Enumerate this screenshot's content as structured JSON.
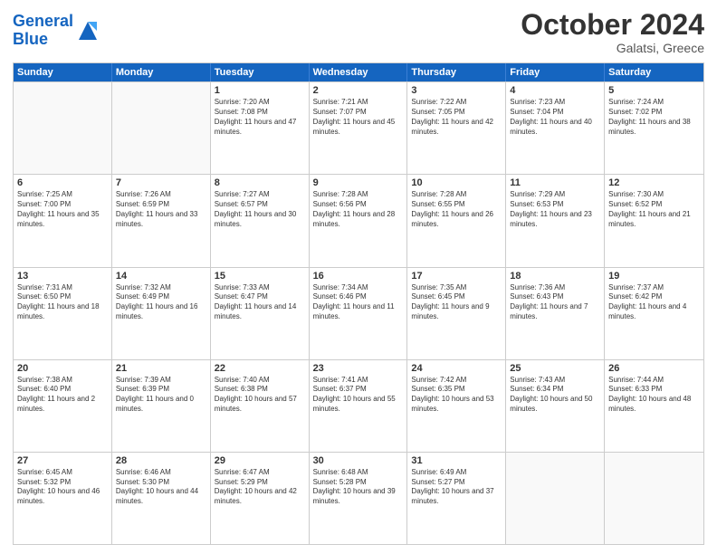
{
  "header": {
    "logo_general": "General",
    "logo_blue": "Blue",
    "month_title": "October 2024",
    "location": "Galatsi, Greece"
  },
  "calendar": {
    "days_of_week": [
      "Sunday",
      "Monday",
      "Tuesday",
      "Wednesday",
      "Thursday",
      "Friday",
      "Saturday"
    ],
    "weeks": [
      [
        {
          "day": "",
          "empty": true
        },
        {
          "day": "",
          "empty": true
        },
        {
          "day": "1",
          "line1": "Sunrise: 7:20 AM",
          "line2": "Sunset: 7:08 PM",
          "line3": "Daylight: 11 hours and 47 minutes."
        },
        {
          "day": "2",
          "line1": "Sunrise: 7:21 AM",
          "line2": "Sunset: 7:07 PM",
          "line3": "Daylight: 11 hours and 45 minutes."
        },
        {
          "day": "3",
          "line1": "Sunrise: 7:22 AM",
          "line2": "Sunset: 7:05 PM",
          "line3": "Daylight: 11 hours and 42 minutes."
        },
        {
          "day": "4",
          "line1": "Sunrise: 7:23 AM",
          "line2": "Sunset: 7:04 PM",
          "line3": "Daylight: 11 hours and 40 minutes."
        },
        {
          "day": "5",
          "line1": "Sunrise: 7:24 AM",
          "line2": "Sunset: 7:02 PM",
          "line3": "Daylight: 11 hours and 38 minutes."
        }
      ],
      [
        {
          "day": "6",
          "line1": "Sunrise: 7:25 AM",
          "line2": "Sunset: 7:00 PM",
          "line3": "Daylight: 11 hours and 35 minutes."
        },
        {
          "day": "7",
          "line1": "Sunrise: 7:26 AM",
          "line2": "Sunset: 6:59 PM",
          "line3": "Daylight: 11 hours and 33 minutes."
        },
        {
          "day": "8",
          "line1": "Sunrise: 7:27 AM",
          "line2": "Sunset: 6:57 PM",
          "line3": "Daylight: 11 hours and 30 minutes."
        },
        {
          "day": "9",
          "line1": "Sunrise: 7:28 AM",
          "line2": "Sunset: 6:56 PM",
          "line3": "Daylight: 11 hours and 28 minutes."
        },
        {
          "day": "10",
          "line1": "Sunrise: 7:28 AM",
          "line2": "Sunset: 6:55 PM",
          "line3": "Daylight: 11 hours and 26 minutes."
        },
        {
          "day": "11",
          "line1": "Sunrise: 7:29 AM",
          "line2": "Sunset: 6:53 PM",
          "line3": "Daylight: 11 hours and 23 minutes."
        },
        {
          "day": "12",
          "line1": "Sunrise: 7:30 AM",
          "line2": "Sunset: 6:52 PM",
          "line3": "Daylight: 11 hours and 21 minutes."
        }
      ],
      [
        {
          "day": "13",
          "line1": "Sunrise: 7:31 AM",
          "line2": "Sunset: 6:50 PM",
          "line3": "Daylight: 11 hours and 18 minutes."
        },
        {
          "day": "14",
          "line1": "Sunrise: 7:32 AM",
          "line2": "Sunset: 6:49 PM",
          "line3": "Daylight: 11 hours and 16 minutes."
        },
        {
          "day": "15",
          "line1": "Sunrise: 7:33 AM",
          "line2": "Sunset: 6:47 PM",
          "line3": "Daylight: 11 hours and 14 minutes."
        },
        {
          "day": "16",
          "line1": "Sunrise: 7:34 AM",
          "line2": "Sunset: 6:46 PM",
          "line3": "Daylight: 11 hours and 11 minutes."
        },
        {
          "day": "17",
          "line1": "Sunrise: 7:35 AM",
          "line2": "Sunset: 6:45 PM",
          "line3": "Daylight: 11 hours and 9 minutes."
        },
        {
          "day": "18",
          "line1": "Sunrise: 7:36 AM",
          "line2": "Sunset: 6:43 PM",
          "line3": "Daylight: 11 hours and 7 minutes."
        },
        {
          "day": "19",
          "line1": "Sunrise: 7:37 AM",
          "line2": "Sunset: 6:42 PM",
          "line3": "Daylight: 11 hours and 4 minutes."
        }
      ],
      [
        {
          "day": "20",
          "line1": "Sunrise: 7:38 AM",
          "line2": "Sunset: 6:40 PM",
          "line3": "Daylight: 11 hours and 2 minutes."
        },
        {
          "day": "21",
          "line1": "Sunrise: 7:39 AM",
          "line2": "Sunset: 6:39 PM",
          "line3": "Daylight: 11 hours and 0 minutes."
        },
        {
          "day": "22",
          "line1": "Sunrise: 7:40 AM",
          "line2": "Sunset: 6:38 PM",
          "line3": "Daylight: 10 hours and 57 minutes."
        },
        {
          "day": "23",
          "line1": "Sunrise: 7:41 AM",
          "line2": "Sunset: 6:37 PM",
          "line3": "Daylight: 10 hours and 55 minutes."
        },
        {
          "day": "24",
          "line1": "Sunrise: 7:42 AM",
          "line2": "Sunset: 6:35 PM",
          "line3": "Daylight: 10 hours and 53 minutes."
        },
        {
          "day": "25",
          "line1": "Sunrise: 7:43 AM",
          "line2": "Sunset: 6:34 PM",
          "line3": "Daylight: 10 hours and 50 minutes."
        },
        {
          "day": "26",
          "line1": "Sunrise: 7:44 AM",
          "line2": "Sunset: 6:33 PM",
          "line3": "Daylight: 10 hours and 48 minutes."
        }
      ],
      [
        {
          "day": "27",
          "line1": "Sunrise: 6:45 AM",
          "line2": "Sunset: 5:32 PM",
          "line3": "Daylight: 10 hours and 46 minutes."
        },
        {
          "day": "28",
          "line1": "Sunrise: 6:46 AM",
          "line2": "Sunset: 5:30 PM",
          "line3": "Daylight: 10 hours and 44 minutes."
        },
        {
          "day": "29",
          "line1": "Sunrise: 6:47 AM",
          "line2": "Sunset: 5:29 PM",
          "line3": "Daylight: 10 hours and 42 minutes."
        },
        {
          "day": "30",
          "line1": "Sunrise: 6:48 AM",
          "line2": "Sunset: 5:28 PM",
          "line3": "Daylight: 10 hours and 39 minutes."
        },
        {
          "day": "31",
          "line1": "Sunrise: 6:49 AM",
          "line2": "Sunset: 5:27 PM",
          "line3": "Daylight: 10 hours and 37 minutes."
        },
        {
          "day": "",
          "empty": true
        },
        {
          "day": "",
          "empty": true
        }
      ]
    ]
  }
}
